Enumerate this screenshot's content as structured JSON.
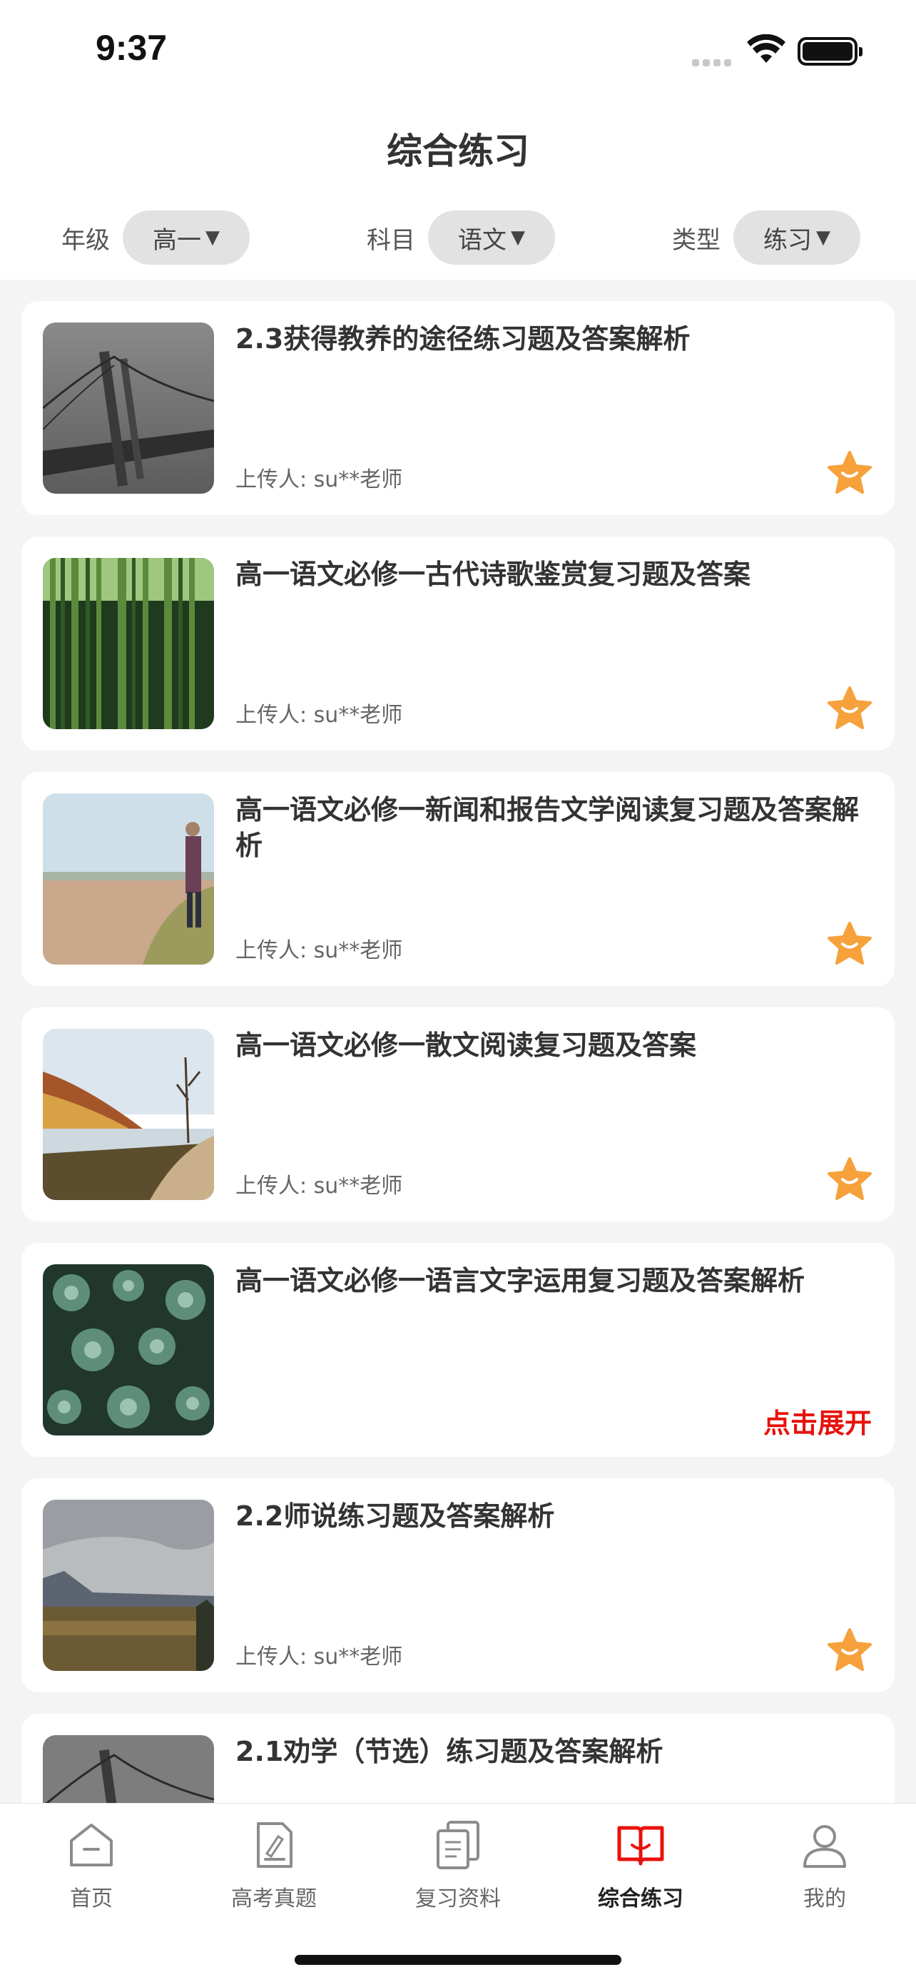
{
  "status_bar": {
    "time": "9:37"
  },
  "header": {
    "title": "综合练习"
  },
  "filters": [
    {
      "label": "年级",
      "value": "高一",
      "arrow": "▼"
    },
    {
      "label": "科目",
      "value": "语文",
      "arrow": "▼"
    },
    {
      "label": "类型",
      "value": "练习",
      "arrow": "▼"
    }
  ],
  "items": [
    {
      "title": "2.3获得教养的途径练习题及答案解析",
      "uploader": "上传人: su**老师",
      "action": "favorite-star"
    },
    {
      "title": "高一语文必修一古代诗歌鉴赏复习题及答案",
      "uploader": "上传人: su**老师",
      "action": "favorite-star"
    },
    {
      "title": "高一语文必修一新闻和报告文学阅读复习题及答案解析",
      "uploader": "上传人: su**老师",
      "action": "favorite-star"
    },
    {
      "title": "高一语文必修一散文阅读复习题及答案",
      "uploader": "上传人: su**老师",
      "action": "favorite-star"
    },
    {
      "title": "高一语文必修一语言文字运用复习题及答案解析",
      "uploader": "",
      "action": "expand",
      "expand_label": "点击展开"
    },
    {
      "title": "2.2师说练习题及答案解析",
      "uploader": "上传人: su**老师",
      "action": "favorite-star"
    },
    {
      "title": "2.1劝学（节选）练习题及答案解析",
      "uploader": "",
      "action": "favorite-star"
    }
  ],
  "tabbar": {
    "tabs": [
      {
        "label": "首页",
        "icon": "home-icon",
        "active": false
      },
      {
        "label": "高考真题",
        "icon": "exam-paper-icon",
        "active": false
      },
      {
        "label": "复习资料",
        "icon": "documents-icon",
        "active": false
      },
      {
        "label": "综合练习",
        "icon": "open-book-icon",
        "active": true
      },
      {
        "label": "我的",
        "icon": "person-icon",
        "active": false
      }
    ]
  },
  "colors": {
    "accent": "#e8120c",
    "star": "#f6a13b",
    "tab_inactive": "#8c8c8c"
  }
}
